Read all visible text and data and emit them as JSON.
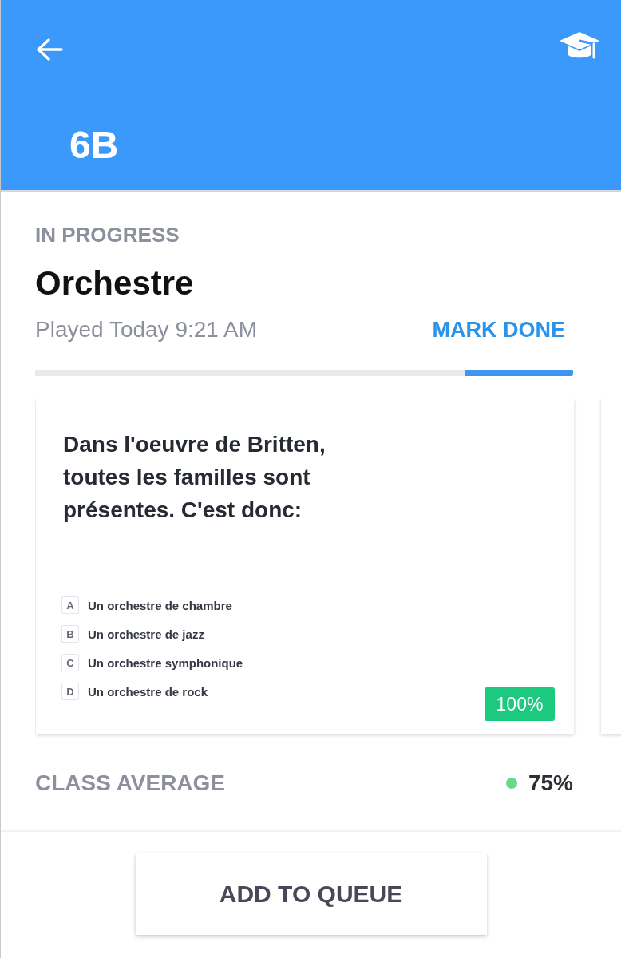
{
  "header": {
    "title": "6B"
  },
  "assignment": {
    "status": "IN PROGRESS",
    "title": "Orchestre",
    "played": "Played Today 9:21 AM",
    "action": "MARK DONE",
    "progress": {
      "level": 0.2
    }
  },
  "cards": [
    {
      "question": "Dans l'oeuvre de Britten, toutes les familles sont présentes. C'est donc:",
      "options": [
        {
          "letter": "A",
          "text": "Un orchestre de chambre"
        },
        {
          "letter": "B",
          "text": "Un orchestre de jazz"
        },
        {
          "letter": "C",
          "text": "Un orchestre symphonique"
        },
        {
          "letter": "D",
          "text": "Un orchestre de rock"
        }
      ],
      "score": "100%"
    }
  ],
  "class_average": {
    "label": "CLASS AVERAGE",
    "value": "75%",
    "color": "#6ad88a"
  },
  "button": "ADD TO QUEUE"
}
